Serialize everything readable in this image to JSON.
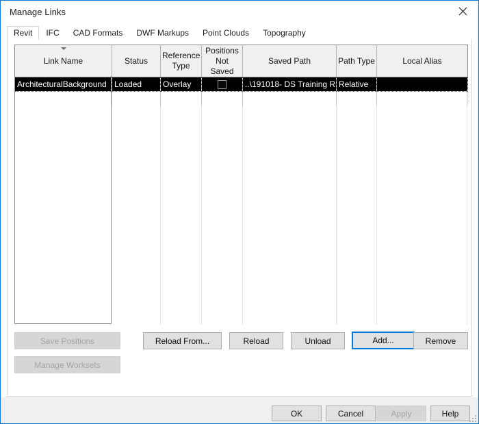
{
  "window": {
    "title": "Manage Links",
    "close_icon": "close-icon"
  },
  "tabs": [
    {
      "label": "Revit",
      "active": true
    },
    {
      "label": "IFC",
      "active": false
    },
    {
      "label": "CAD Formats",
      "active": false
    },
    {
      "label": "DWF Markups",
      "active": false
    },
    {
      "label": "Point Clouds",
      "active": false
    },
    {
      "label": "Topography",
      "active": false
    }
  ],
  "table": {
    "sort_column": "Link Name",
    "sort_direction": "descending",
    "columns": [
      {
        "label": "Link Name",
        "sorted": true
      },
      {
        "label": "Status",
        "sorted": false
      },
      {
        "label": "Reference\nType",
        "line1": "Reference",
        "line2": "Type",
        "sorted": false
      },
      {
        "label": "Positions\nNot Saved",
        "line1": "Positions",
        "line2": "Not Saved",
        "sorted": false
      },
      {
        "label": "Saved Path",
        "sorted": false
      },
      {
        "label": "Path Type",
        "sorted": false
      },
      {
        "label": "Local Alias",
        "sorted": false
      }
    ],
    "rows": [
      {
        "selected": true,
        "link_name": "ArchitecturalBackground",
        "status": "Loaded",
        "reference_type": "Overlay",
        "positions_not_saved": false,
        "saved_path": "..\\191018- DS Training R",
        "path_type": "Relative",
        "local_alias": ""
      }
    ]
  },
  "side_buttons": [
    {
      "label": "Save Positions",
      "enabled": false
    },
    {
      "label": "Manage Worksets",
      "enabled": false
    }
  ],
  "action_buttons": [
    {
      "label": "Reload From...",
      "enabled": true,
      "focused": false
    },
    {
      "label": "Reload",
      "enabled": true,
      "focused": false
    },
    {
      "label": "Unload",
      "enabled": true,
      "focused": false
    },
    {
      "label": "Add...",
      "enabled": true,
      "focused": true
    },
    {
      "label": "Remove",
      "enabled": true,
      "focused": false
    }
  ],
  "footer_buttons": [
    {
      "label": "OK",
      "enabled": true
    },
    {
      "label": "Cancel",
      "enabled": true
    },
    {
      "label": "Apply",
      "enabled": false
    },
    {
      "label": "Help",
      "enabled": true
    }
  ],
  "colors": {
    "accent": "#0078d7",
    "selection_bg": "#000000",
    "selection_fg": "#ffffff",
    "header_bg": "#f0f0f0",
    "button_bg": "#e1e1e1",
    "footer_bg": "#f0f0f0"
  }
}
